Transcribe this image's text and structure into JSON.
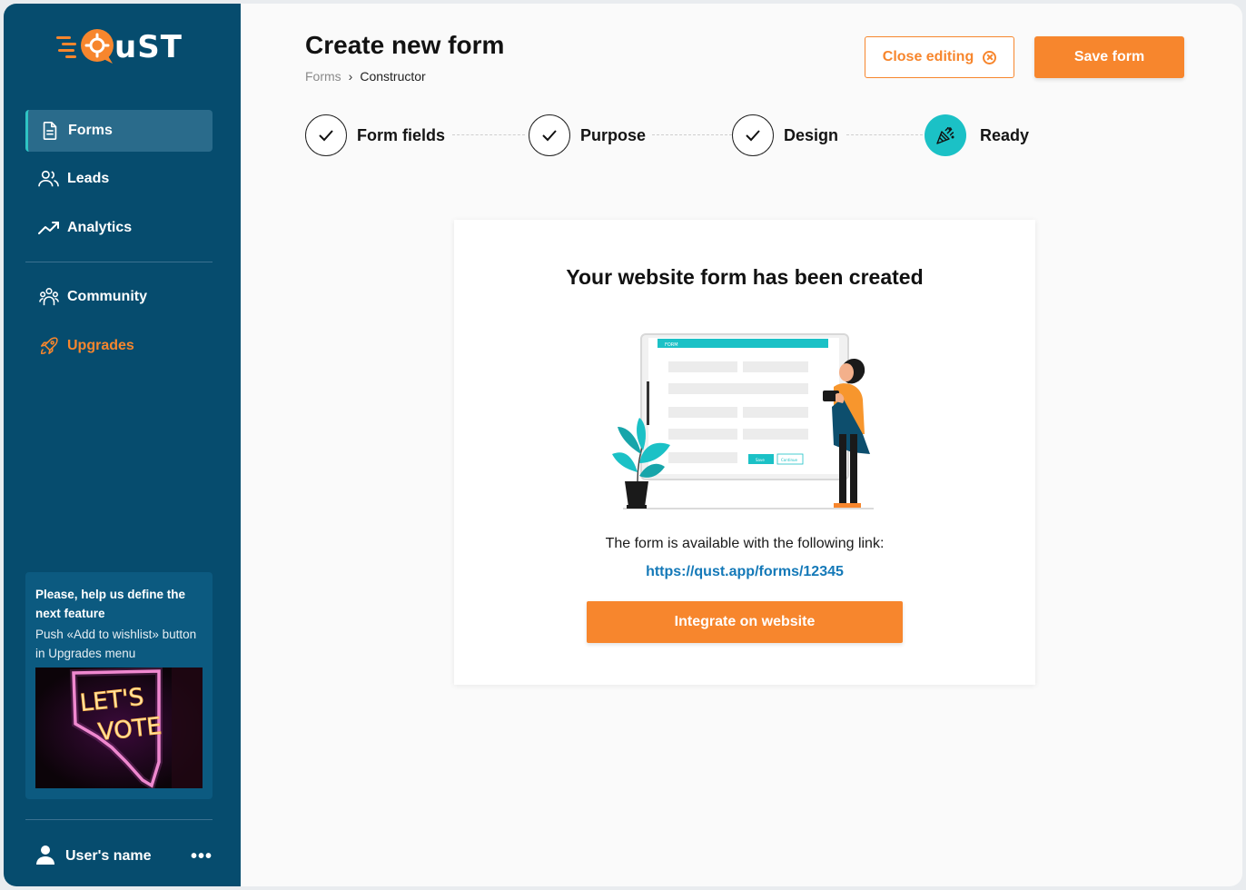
{
  "app": {
    "logo_text": "uST"
  },
  "sidebar": {
    "items": [
      {
        "label": "Forms",
        "icon": "document-icon"
      },
      {
        "label": "Leads",
        "icon": "users-icon"
      },
      {
        "label": "Analytics",
        "icon": "trend-up-icon"
      },
      {
        "label": "Community",
        "icon": "community-icon"
      },
      {
        "label": "Upgrades",
        "icon": "rocket-icon"
      }
    ],
    "promo": {
      "title": "Please, help us define the next feature",
      "text": "Push «Add to wishlist» button in Upgrades menu",
      "image_text_line1": "LET'S",
      "image_text_line2": "VOTE"
    },
    "user": {
      "name": "User's name",
      "menu_icon": "more-dots-icon"
    }
  },
  "header": {
    "title": "Create new form",
    "breadcrumb": [
      "Forms",
      "Constructor"
    ],
    "close_label": "Close editing",
    "save_label": "Save form"
  },
  "steps": [
    {
      "label": "Form fields",
      "state": "done"
    },
    {
      "label": "Purpose",
      "state": "done"
    },
    {
      "label": "Design",
      "state": "done"
    },
    {
      "label": "Ready",
      "state": "current"
    }
  ],
  "card": {
    "title": "Your website form has been created",
    "text": "The form is available with the following link:",
    "link": "https://qust.app/forms/12345",
    "button": "Integrate on website",
    "illustration": {
      "form_header": "FORM",
      "btn1": "Save",
      "btn2": "Continue"
    }
  },
  "colors": {
    "sidebar": "#064c6e",
    "accent_orange": "#f7862d",
    "accent_teal": "#1bc1c6",
    "link": "#1479b8"
  }
}
